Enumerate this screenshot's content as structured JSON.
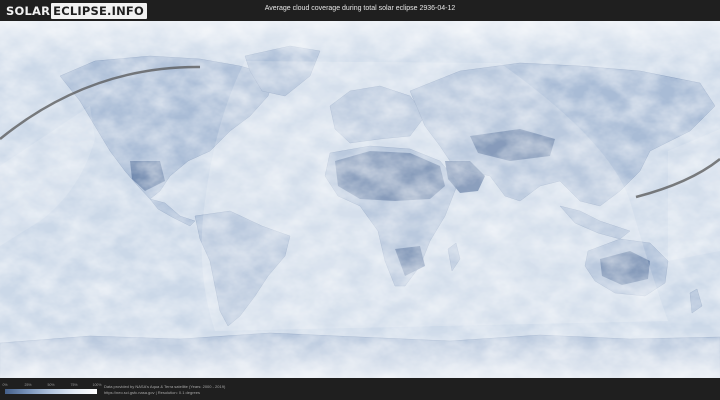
{
  "header": {
    "logo_solar": "SOLAR",
    "logo_eclipse": "ECLIPSE.INFO",
    "title": "Average cloud coverage during total solar eclipse 2936-04-12"
  },
  "legend": {
    "ticks": [
      "0%",
      "25%",
      "50%",
      "75%",
      "100%"
    ],
    "gradient_colors": [
      "#45608a",
      "#7a95bb",
      "#b3c6df",
      "#e2ebf5",
      "#ffffff"
    ]
  },
  "credits": {
    "line1": "Data provided by NASA's Aqua & Terra satellite (Years: 2000 - 2019)",
    "line2": "https://neo.sci.gsfc.nasa.gov | Resolution: 0.1 degrees"
  },
  "map": {
    "ocean_color": "#cfdbea",
    "land_color": "#a9bcd6",
    "desert_color": "#5f7aa3",
    "eclipse_path_color": "#555555"
  }
}
